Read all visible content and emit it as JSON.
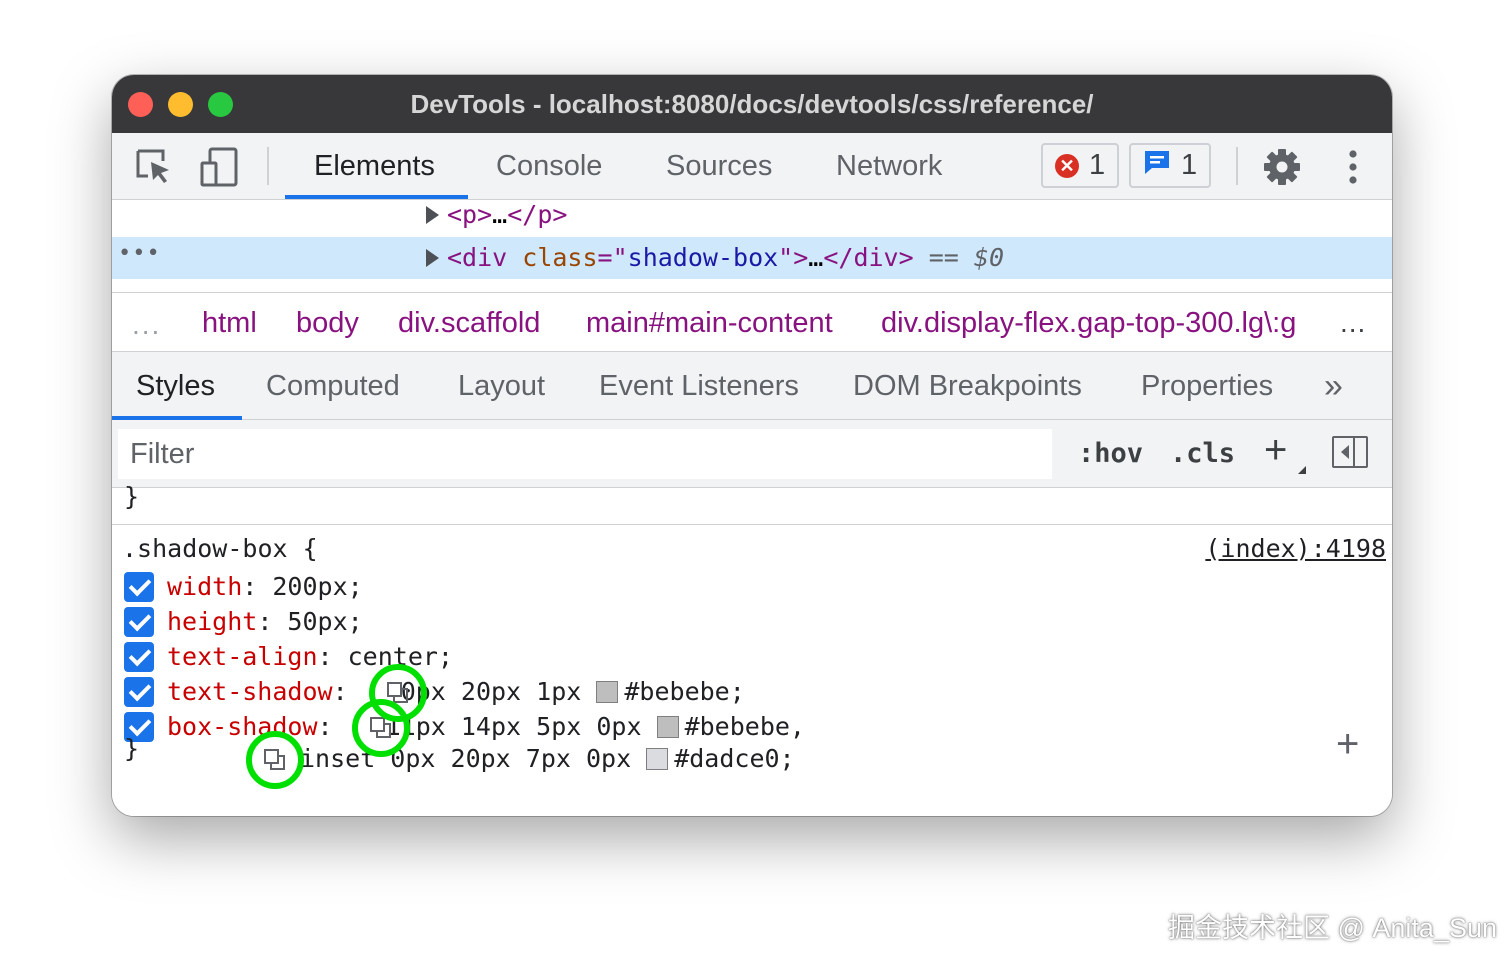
{
  "window": {
    "title": "DevTools - localhost:8080/docs/devtools/css/reference/"
  },
  "toolbar": {
    "inspect_icon": "inspect-element-icon",
    "device_icon": "device-toolbar-icon",
    "tabs": [
      "Elements",
      "Console",
      "Sources",
      "Network"
    ],
    "active_tab": "Elements",
    "error_count": "1",
    "message_count": "1",
    "settings_icon": "gear-icon",
    "more_icon": "kebab-menu-icon"
  },
  "dom": {
    "line1": {
      "open": "<p>",
      "ellipsis": "…",
      "close": "</p>"
    },
    "line2": {
      "open_tag": "<div",
      "attr_name": "class",
      "equals_quote": "=\"",
      "attr_value": "shadow-box",
      "close_quote": "\">",
      "ellipsis": "…",
      "close_tag": "</div>",
      "equals": "==",
      "dollar": "$0"
    },
    "dots": "•••"
  },
  "breadcrumbs": {
    "left_ellipsis": "...",
    "items": [
      "html",
      "body",
      "div.scaffold",
      "main#main-content",
      "div.display-flex.gap-top-300.lg\\:g"
    ],
    "right_ellipsis": "..."
  },
  "subtabs": {
    "items": [
      "Styles",
      "Computed",
      "Layout",
      "Event Listeners",
      "DOM Breakpoints",
      "Properties"
    ],
    "active": "Styles",
    "overflow": "»"
  },
  "filter": {
    "placeholder": "Filter",
    "hov": ":hov",
    "cls": ".cls",
    "add": "+",
    "sidebar_icon": "toggle-sidebar-icon"
  },
  "styles": {
    "prev_brace": "}",
    "selector": ".shadow-box {",
    "source": "(index):4198",
    "declarations": [
      {
        "prop": "width",
        "value": "200px;"
      },
      {
        "prop": "height",
        "value": "50px;"
      },
      {
        "prop": "text-align",
        "value": "center;"
      },
      {
        "prop": "text-shadow",
        "value_before": "0px 20px 1px",
        "swatch_color": "#bebebe",
        "color_text": "#bebebe;"
      },
      {
        "prop": "box-shadow",
        "value_before": "11px 14px 5px 0px",
        "swatch_color": "#bebebe",
        "color_text": "#bebebe,"
      }
    ],
    "continuation": {
      "value_before": "inset 0px 20px 7px 0px",
      "swatch_color": "#dadce0",
      "color_text": "#dadce0;"
    },
    "close_brace": "}",
    "add_icon": "+",
    "highlight_color": "#00e000"
  },
  "watermark": "掘金技术社区 @ Anita_Sun"
}
